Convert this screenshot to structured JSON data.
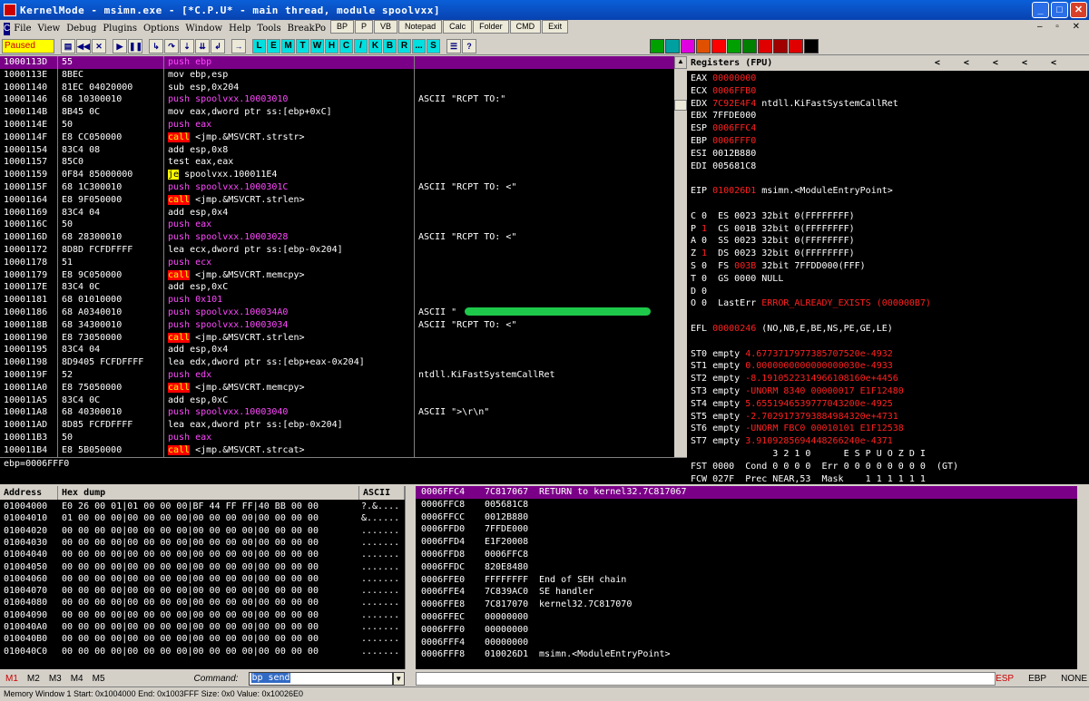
{
  "window": {
    "title": "KernelMode - msimn.exe - [*C.P.U* - main thread, module spoolvxx]"
  },
  "top_buttons": [
    "BP",
    "P",
    "VB",
    "Notepad",
    "Calc",
    "Folder",
    "CMD",
    "Exit"
  ],
  "menu": [
    "File",
    "View",
    "Debug",
    "Plugins",
    "Options",
    "Window",
    "Help",
    "Tools",
    "BreakPo"
  ],
  "toolbar": {
    "status": "Paused",
    "letters": [
      "L",
      "E",
      "M",
      "T",
      "W",
      "H",
      "C",
      "/",
      "K",
      "B",
      "R",
      "...",
      "S"
    ],
    "colors": [
      "#00a000",
      "#00a0a0",
      "#e000e0",
      "#e05000",
      "#ff0000",
      "#00a000",
      "#008000",
      "#e00000",
      "#a00000",
      "#e00000",
      "#000000"
    ]
  },
  "cpu_rows": [
    {
      "addr": "1000113D",
      "hex": "55",
      "asm": "push ebp",
      "com": "",
      "t": "push"
    },
    {
      "addr": "1000113E",
      "hex": "8BEC",
      "asm": "mov ebp,esp",
      "com": "",
      "t": ""
    },
    {
      "addr": "10001140",
      "hex": "81EC 04020000",
      "asm": "sub esp,0x204",
      "com": "",
      "t": ""
    },
    {
      "addr": "10001146",
      "hex": "68 10300010",
      "asm": "push spoolvxx.10003010",
      "com": "ASCII \"RCPT TO:\"",
      "t": "push"
    },
    {
      "addr": "1000114B",
      "hex": "8B45 0C",
      "asm": "mov eax,dword ptr ss:[ebp+0xC]",
      "com": "",
      "t": ""
    },
    {
      "addr": "1000114E",
      "hex": "50",
      "asm": "push eax",
      "com": "",
      "t": "push"
    },
    {
      "addr": "1000114F",
      "hex": "E8 CC050000",
      "asm": "call <jmp.&MSVCRT.strstr>",
      "com": "",
      "t": "call"
    },
    {
      "addr": "10001154",
      "hex": "83C4 08",
      "asm": "add esp,0x8",
      "com": "",
      "t": ""
    },
    {
      "addr": "10001157",
      "hex": "85C0",
      "asm": "test eax,eax",
      "com": "",
      "t": ""
    },
    {
      "addr": "10001159",
      "hex": "0F84 85000000",
      "asm": "je spoolvxx.100011E4",
      "com": "",
      "t": "je"
    },
    {
      "addr": "1000115F",
      "hex": "68 1C300010",
      "asm": "push spoolvxx.1000301C",
      "com": "ASCII \"RCPT TO: <\"",
      "t": "push"
    },
    {
      "addr": "10001164",
      "hex": "E8 9F050000",
      "asm": "call <jmp.&MSVCRT.strlen>",
      "com": "",
      "t": "call"
    },
    {
      "addr": "10001169",
      "hex": "83C4 04",
      "asm": "add esp,0x4",
      "com": "",
      "t": ""
    },
    {
      "addr": "1000116C",
      "hex": "50",
      "asm": "push eax",
      "com": "",
      "t": "push"
    },
    {
      "addr": "1000116D",
      "hex": "68 28300010",
      "asm": "push spoolvxx.10003028",
      "com": "ASCII \"RCPT TO: <\"",
      "t": "push"
    },
    {
      "addr": "10001172",
      "hex": "8D8D FCFDFFFF",
      "asm": "lea ecx,dword ptr ss:[ebp-0x204]",
      "com": "",
      "t": ""
    },
    {
      "addr": "10001178",
      "hex": "51",
      "asm": "push ecx",
      "com": "",
      "t": "push"
    },
    {
      "addr": "10001179",
      "hex": "E8 9C050000",
      "asm": "call <jmp.&MSVCRT.memcpy>",
      "com": "",
      "t": "call"
    },
    {
      "addr": "1000117E",
      "hex": "83C4 0C",
      "asm": "add esp,0xC",
      "com": "",
      "t": ""
    },
    {
      "addr": "10001181",
      "hex": "68 01010000",
      "asm": "push 0x101",
      "com": "",
      "t": "push"
    },
    {
      "addr": "10001186",
      "hex": "68 A0340010",
      "asm": "push spoolvxx.100034A0",
      "com": "ASCII \"",
      "t": "push"
    },
    {
      "addr": "1000118B",
      "hex": "68 34300010",
      "asm": "push spoolvxx.10003034",
      "com": "ASCII \"RCPT TO: <\"",
      "t": "push"
    },
    {
      "addr": "10001190",
      "hex": "E8 73050000",
      "asm": "call <jmp.&MSVCRT.strlen>",
      "com": "",
      "t": "call"
    },
    {
      "addr": "10001195",
      "hex": "83C4 04",
      "asm": "add esp,0x4",
      "com": "",
      "t": ""
    },
    {
      "addr": "10001198",
      "hex": "8D9405 FCFDFFFF",
      "asm": "lea edx,dword ptr ss:[ebp+eax-0x204]",
      "com": "",
      "t": ""
    },
    {
      "addr": "1000119F",
      "hex": "52",
      "asm": "push edx",
      "com": "ntdll.KiFastSystemCallRet",
      "t": "push"
    },
    {
      "addr": "100011A0",
      "hex": "E8 75050000",
      "asm": "call <jmp.&MSVCRT.memcpy>",
      "com": "",
      "t": "call"
    },
    {
      "addr": "100011A5",
      "hex": "83C4 0C",
      "asm": "add esp,0xC",
      "com": "",
      "t": ""
    },
    {
      "addr": "100011A8",
      "hex": "68 40300010",
      "asm": "push spoolvxx.10003040",
      "com": "ASCII \">\\r\\n\"",
      "t": "push"
    },
    {
      "addr": "100011AD",
      "hex": "8D85 FCFDFFFF",
      "asm": "lea eax,dword ptr ss:[ebp-0x204]",
      "com": "",
      "t": ""
    },
    {
      "addr": "100011B3",
      "hex": "50",
      "asm": "push eax",
      "com": "",
      "t": "push"
    },
    {
      "addr": "100011B4",
      "hex": "E8 5B050000",
      "asm": "call <jmp.&MSVCRT.strcat>",
      "com": "",
      "t": "call"
    }
  ],
  "info_line": "ebp=0006FFF0",
  "registers": {
    "title": "Registers (FPU)",
    "arrows": "<<<<<",
    "lines": [
      [
        [
          "EAX ",
          ""
        ],
        [
          "00000000",
          "red"
        ]
      ],
      [
        [
          "ECX ",
          ""
        ],
        [
          "0006FFB0",
          "red"
        ]
      ],
      [
        [
          "EDX ",
          ""
        ],
        [
          "7C92E4F4",
          "red"
        ],
        [
          " ntdll.KiFastSystemCallRet",
          ""
        ]
      ],
      [
        [
          "EBX 7FFDE000",
          ""
        ]
      ],
      [
        [
          "ESP ",
          ""
        ],
        [
          "0006FFC4",
          "red"
        ]
      ],
      [
        [
          "EBP ",
          ""
        ],
        [
          "0006FFF0",
          "red"
        ]
      ],
      [
        [
          "ESI 0012B880",
          ""
        ]
      ],
      [
        [
          "EDI 005681C8",
          ""
        ]
      ],
      [
        [
          "",
          ""
        ]
      ],
      [
        [
          "EIP ",
          ""
        ],
        [
          "010026D1",
          "red"
        ],
        [
          " msimn.<ModuleEntryPoint>",
          ""
        ]
      ],
      [
        [
          "",
          ""
        ]
      ],
      [
        [
          "C 0  ES 0023 32bit 0(FFFFFFFF)",
          ""
        ]
      ],
      [
        [
          "P ",
          ""
        ],
        [
          "1",
          "red"
        ],
        [
          "  CS 001B 32bit 0(FFFFFFFF)",
          ""
        ]
      ],
      [
        [
          "A 0  SS 0023 32bit 0(FFFFFFFF)",
          ""
        ]
      ],
      [
        [
          "Z ",
          ""
        ],
        [
          "1",
          "red"
        ],
        [
          "  DS 0023 32bit 0(FFFFFFFF)",
          ""
        ]
      ],
      [
        [
          "S 0  FS ",
          ""
        ],
        [
          "003B",
          "red"
        ],
        [
          " 32bit 7FFDD000(FFF)",
          ""
        ]
      ],
      [
        [
          "T 0  GS 0000 NULL",
          ""
        ]
      ],
      [
        [
          "D 0",
          ""
        ]
      ],
      [
        [
          "O 0  LastErr ",
          ""
        ],
        [
          "ERROR_ALREADY_EXISTS (000000B7)",
          "red"
        ]
      ],
      [
        [
          "",
          ""
        ]
      ],
      [
        [
          "EFL ",
          ""
        ],
        [
          "00000246",
          "red"
        ],
        [
          " (NO,NB,E,BE,NS,PE,GE,LE)",
          ""
        ]
      ],
      [
        [
          "",
          ""
        ]
      ],
      [
        [
          "ST0 empty ",
          ""
        ],
        [
          "4.6773717977385707520e-4932",
          "red"
        ]
      ],
      [
        [
          "ST1 empty ",
          ""
        ],
        [
          "0.0000000000000000030e-4933",
          "red"
        ]
      ],
      [
        [
          "ST2 empty ",
          ""
        ],
        [
          "-8.1910522314966108160e+4456",
          "red"
        ]
      ],
      [
        [
          "ST3 empty ",
          ""
        ],
        [
          "-UNORM 8340 00000017 E1F12480",
          "red"
        ]
      ],
      [
        [
          "ST4 empty ",
          ""
        ],
        [
          "5.6551946539777043200e-4925",
          "red"
        ]
      ],
      [
        [
          "ST5 empty ",
          ""
        ],
        [
          "-2.7029173793884984320e+4731",
          "red"
        ]
      ],
      [
        [
          "ST6 empty ",
          ""
        ],
        [
          "-UNORM FBC0 00010101 E1F12538",
          "red"
        ]
      ],
      [
        [
          "ST7 empty ",
          ""
        ],
        [
          "3.9109285694448266240e-4371",
          "red"
        ]
      ],
      [
        [
          "               3 2 1 0      E S P U O Z D I",
          ""
        ]
      ],
      [
        [
          "FST 0000  Cond 0 0 0 0  Err 0 0 0 0 0 0 0 0  (GT)",
          ""
        ]
      ],
      [
        [
          "FCW 027F  Prec NEAR,53  Mask    1 1 1 1 1 1",
          ""
        ]
      ]
    ]
  },
  "dump": {
    "headers": {
      "address": "Address",
      "hex": "Hex dump",
      "ascii": "ASCII"
    },
    "rows": [
      {
        "addr": "01004000",
        "hex": "E0 26 00 01|01 00 00 00|BF 44 FF FF|40 BB 00 00",
        "ascii": "?.&...."
      },
      {
        "addr": "01004010",
        "hex": "01 00 00 00|00 00 00 00|00 00 00 00|00 00 00 00",
        "ascii": "&......"
      },
      {
        "addr": "01004020",
        "hex": "00 00 00 00|00 00 00 00|00 00 00 00|00 00 00 00",
        "ascii": "......."
      },
      {
        "addr": "01004030",
        "hex": "00 00 00 00|00 00 00 00|00 00 00 00|00 00 00 00",
        "ascii": "......."
      },
      {
        "addr": "01004040",
        "hex": "00 00 00 00|00 00 00 00|00 00 00 00|00 00 00 00",
        "ascii": "......."
      },
      {
        "addr": "01004050",
        "hex": "00 00 00 00|00 00 00 00|00 00 00 00|00 00 00 00",
        "ascii": "......."
      },
      {
        "addr": "01004060",
        "hex": "00 00 00 00|00 00 00 00|00 00 00 00|00 00 00 00",
        "ascii": "......."
      },
      {
        "addr": "01004070",
        "hex": "00 00 00 00|00 00 00 00|00 00 00 00|00 00 00 00",
        "ascii": "......."
      },
      {
        "addr": "01004080",
        "hex": "00 00 00 00|00 00 00 00|00 00 00 00|00 00 00 00",
        "ascii": "......."
      },
      {
        "addr": "01004090",
        "hex": "00 00 00 00|00 00 00 00|00 00 00 00|00 00 00 00",
        "ascii": "......."
      },
      {
        "addr": "010040A0",
        "hex": "00 00 00 00|00 00 00 00|00 00 00 00|00 00 00 00",
        "ascii": "......."
      },
      {
        "addr": "010040B0",
        "hex": "00 00 00 00|00 00 00 00|00 00 00 00|00 00 00 00",
        "ascii": "......."
      },
      {
        "addr": "010040C0",
        "hex": "00 00 00 00|00 00 00 00|00 00 00 00|00 00 00 00",
        "ascii": "......."
      }
    ]
  },
  "stack": {
    "rows": [
      {
        "addr": "0006FFC4",
        "val": "7C817067",
        "com": "RETURN to kernel32.7C817067"
      },
      {
        "addr": "0006FFC8",
        "val": "005681C8",
        "com": ""
      },
      {
        "addr": "0006FFCC",
        "val": "0012B880",
        "com": ""
      },
      {
        "addr": "0006FFD0",
        "val": "7FFDE000",
        "com": ""
      },
      {
        "addr": "0006FFD4",
        "val": "E1F20008",
        "com": ""
      },
      {
        "addr": "0006FFD8",
        "val": "0006FFC8",
        "com": ""
      },
      {
        "addr": "0006FFDC",
        "val": "820E8480",
        "com": ""
      },
      {
        "addr": "0006FFE0",
        "val": "FFFFFFFF",
        "com": "End of SEH chain"
      },
      {
        "addr": "0006FFE4",
        "val": "7C839AC0",
        "com": "SE handler"
      },
      {
        "addr": "0006FFE8",
        "val": "7C817070",
        "com": "kernel32.7C817070"
      },
      {
        "addr": "0006FFEC",
        "val": "00000000",
        "com": ""
      },
      {
        "addr": "0006FFF0",
        "val": "00000000",
        "com": ""
      },
      {
        "addr": "0006FFF4",
        "val": "00000000",
        "com": ""
      },
      {
        "addr": "0006FFF8",
        "val": "010026D1",
        "com": "msimn.<ModuleEntryPoint>"
      }
    ]
  },
  "cmdbar": {
    "m_labels": [
      "M1",
      "M2",
      "M3",
      "M4",
      "M5"
    ],
    "command_label": "Command:",
    "command_value": "bp send",
    "right": [
      "ESP",
      "EBP",
      "NONE"
    ]
  },
  "status": "Memory Window 1  Start: 0x1004000  End: 0x1003FFF  Size: 0x0  Value: 0x10026E0"
}
